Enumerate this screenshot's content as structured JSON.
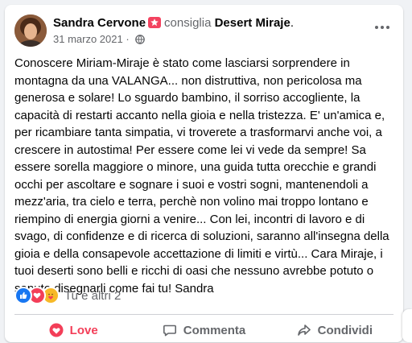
{
  "post": {
    "author": "Sandra Cervone",
    "verb": "consiglia",
    "page": "Desert Miraje",
    "dot": ".",
    "date": "31 marzo 2021",
    "separator": "·",
    "body": [
      "Conoscere Miriam-Miraje è stato come lasciarsi sorprendere in montagna da una VALANGA... non distruttiva, non pericolosa ma generosa e solare! Lo sguardo bambino, il sorriso accogliente, la capacità di restarti accanto nella gioia e nella tristezza. E' un'amica e, per ricambiare tanta simpatia, vi troverete a trasformarvi anche voi, a crescere in autostima! Per essere come lei vi vede da sempre! Sa essere sorella maggiore o minore, una guida tutta orecchie e grandi occhi per ascoltare e sognare i suoi e vostri sogni, mantenendoli a mezz'aria, tra cielo e terra, perchè non volino mai troppo lontano e riempino di energia giorni a venire... Con lei, incontri di lavoro e di svago, di confidenze e di ricerca di soluzioni, saranno all'insegna della gioia e della consapevole accettazione di limiti e virtù... Cara Miraje, i tuoi deserti sono belli e ricchi di oasi che nessuno avrebbe potuto o saputo disegnarli come fai tu!  Sandra"
    ],
    "reactions": {
      "icons": [
        "like-icon",
        "love-icon",
        "care-icon"
      ],
      "summary": "Tu e altri 2"
    },
    "actions": {
      "love": "Love",
      "comment": "Commenta",
      "share": "Condividi"
    }
  },
  "colors": {
    "love": "#f33e58",
    "like": "#1877f2",
    "recommend": "#f3425f",
    "muted": "#65676b"
  }
}
